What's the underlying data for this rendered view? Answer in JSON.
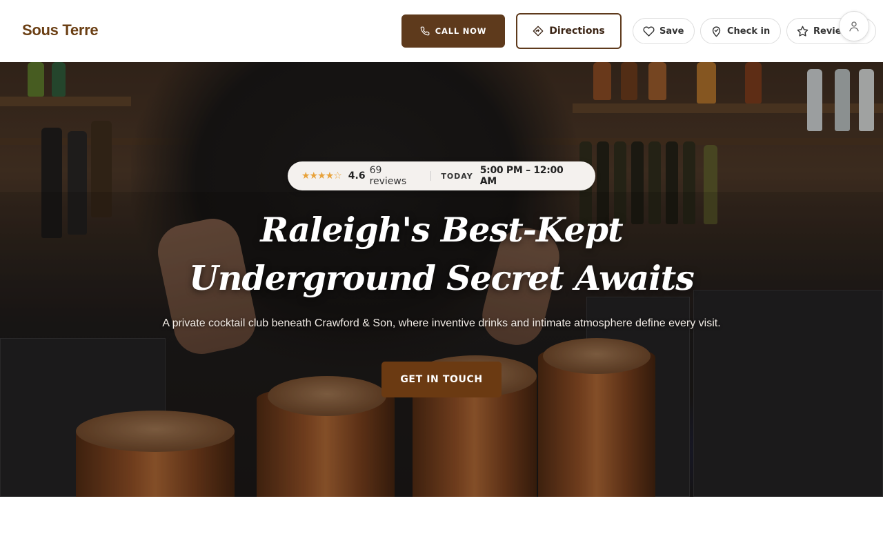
{
  "header": {
    "brand": "Sous Terre",
    "call_label": "CALL NOW",
    "directions_label": "Directions",
    "save_label": "Save",
    "checkin_label": "Check in",
    "review_label": "Review",
    "icons": {
      "call": "phone-icon",
      "directions": "directions-icon",
      "save": "heart-icon",
      "checkin": "map-pin-icon",
      "review": "star-icon",
      "account": "user-icon"
    }
  },
  "hero": {
    "rating": {
      "stars": "★★★★☆",
      "score": "4.6",
      "reviews": "69 reviews",
      "today_label": "TODAY",
      "hours": "5:00 PM – 12:00 AM",
      "star_fraction": 0.92
    },
    "headline": "Raleigh's Best-Kept Underground Secret Awaits",
    "subline": "A private cocktail club beneath Crawford & Son, where inventive drinks and intimate atmosphere define every visit.",
    "cta_label": "GET IN TOUCH"
  },
  "colors": {
    "brand": "#6b3f14",
    "button_dark": "#5e3a1c",
    "cta": "#6b3a12",
    "star": "#e8a23a"
  }
}
